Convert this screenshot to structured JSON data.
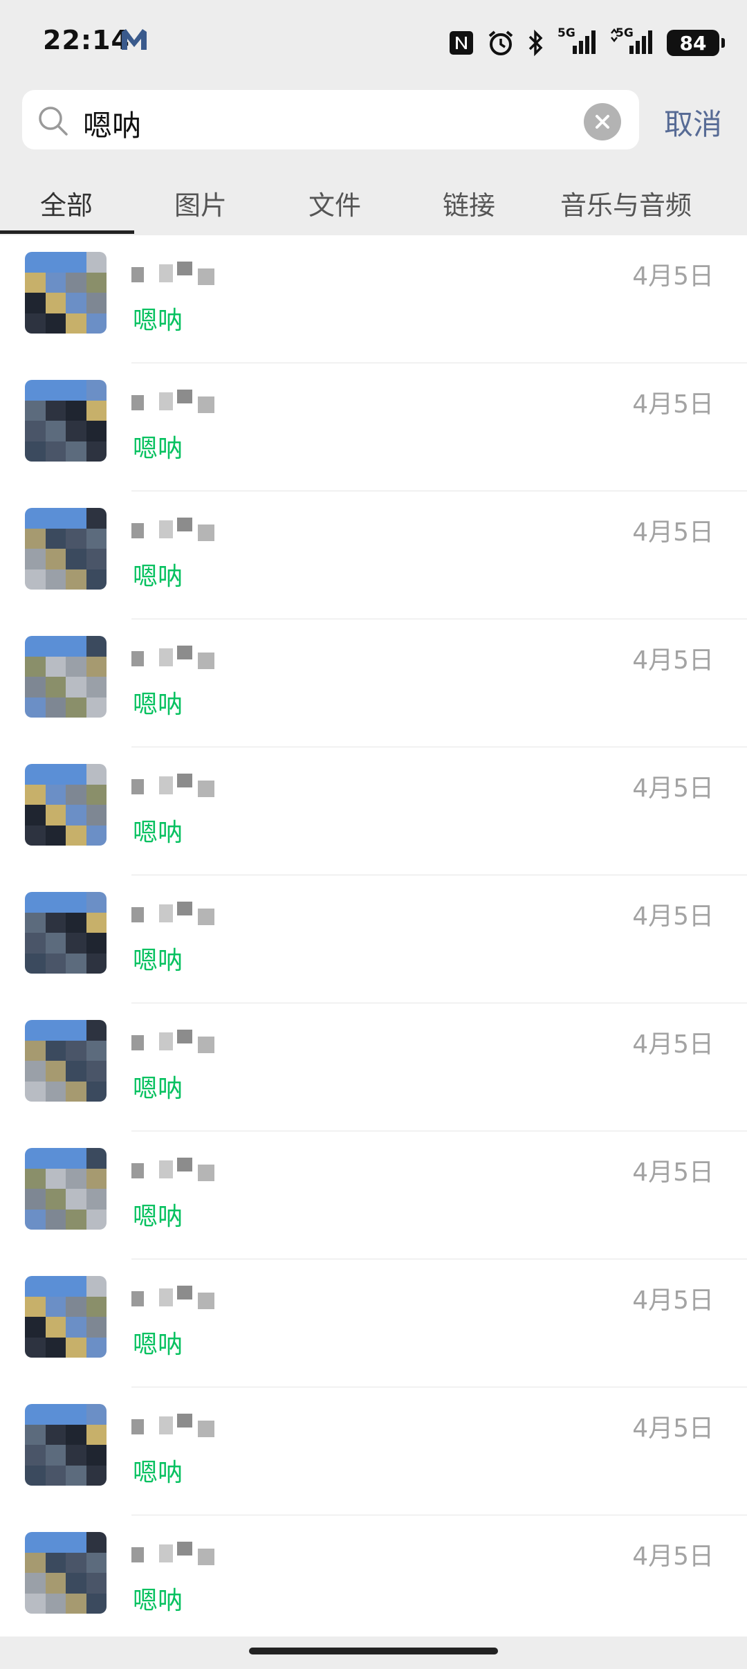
{
  "status_bar": {
    "time": "22:14",
    "battery": "84",
    "network_1": "5G",
    "network_2": "5G",
    "icons": [
      "nfc-icon",
      "alarm-icon",
      "bluetooth-icon",
      "signal-5g-icon",
      "signal-5g-icon",
      "battery-icon"
    ]
  },
  "search": {
    "query": "嗯呐",
    "cancel_label": "取消"
  },
  "tabs": [
    {
      "label": "全部",
      "active": true
    },
    {
      "label": "图片",
      "active": false
    },
    {
      "label": "文件",
      "active": false
    },
    {
      "label": "链接",
      "active": false
    },
    {
      "label": "音乐与音频",
      "active": false
    }
  ],
  "results": [
    {
      "message": "嗯呐",
      "date": "4月5日"
    },
    {
      "message": "嗯呐",
      "date": "4月5日"
    },
    {
      "message": "嗯呐",
      "date": "4月5日"
    },
    {
      "message": "嗯呐",
      "date": "4月5日"
    },
    {
      "message": "嗯呐",
      "date": "4月5日"
    },
    {
      "message": "嗯呐",
      "date": "4月5日"
    },
    {
      "message": "嗯呐",
      "date": "4月5日"
    },
    {
      "message": "嗯呐",
      "date": "4月5日"
    },
    {
      "message": "嗯呐",
      "date": "4月5日"
    },
    {
      "message": "嗯呐",
      "date": "4月5日"
    },
    {
      "message": "嗯呐",
      "date": "4月5日"
    }
  ],
  "colors": {
    "accent_green": "#07c160",
    "link_blue": "#576b95",
    "date_gray": "#a3a3a3",
    "background": "#ededed"
  }
}
